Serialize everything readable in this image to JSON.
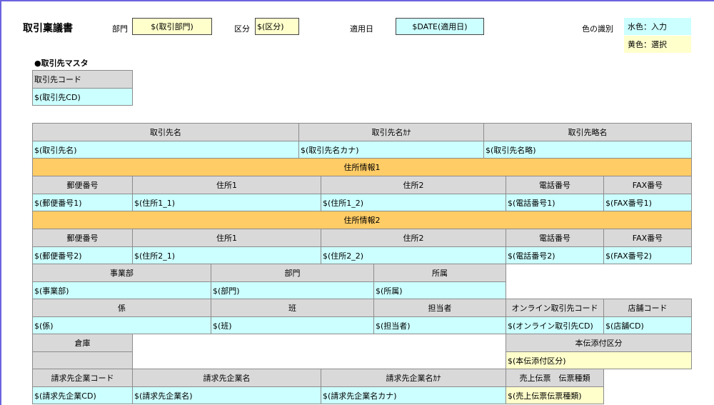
{
  "header": {
    "title": "取引稟議書",
    "dept_label": "部門",
    "dept_value": "$(取引部門)",
    "category_label": "区分",
    "category_value": "$(区分)",
    "apply_date_label": "適用日",
    "apply_date_value": "$DATE(適用日)",
    "color_legend_label": "色の識別",
    "legend_input": "水色：入力",
    "legend_select": "黄色：選択"
  },
  "master": {
    "section_title": "●取引先マスタ",
    "code_header": "取引先コード",
    "code_value": "$(取引先CD)"
  },
  "names": {
    "name_header": "取引先名",
    "kana_header": "取引先名ｶﾅ",
    "short_header": "取引先略名",
    "name_value": "$(取引先名)",
    "kana_value": "$(取引先名カナ)",
    "short_value": "$(取引先名略)"
  },
  "address1": {
    "band": "住所情報1",
    "zip_header": "郵便番号",
    "addr1_header": "住所1",
    "addr2_header": "住所2",
    "tel_header": "電話番号",
    "fax_header": "FAX番号",
    "zip_value": "$(郵便番号1)",
    "addr1_value": "$(住所1_1)",
    "addr2_value": "$(住所1_2)",
    "tel_value": "$(電話番号1)",
    "fax_value": "$(FAX番号1)"
  },
  "address2": {
    "band": "住所情報2",
    "zip_header": "郵便番号",
    "addr1_header": "住所1",
    "addr2_header": "住所2",
    "tel_header": "電話番号",
    "fax_header": "FAX番号",
    "zip_value": "$(郵便番号2)",
    "addr1_value": "$(住所2_1)",
    "addr2_value": "$(住所2_2)",
    "tel_value": "$(電話番号2)",
    "fax_value": "$(FAX番号2)"
  },
  "org": {
    "division_header": "事業部",
    "dept_header": "部門",
    "belong_header": "所属",
    "division_value": "$(事業部)",
    "dept_value": "$(部門)",
    "belong_value": "$(所属)"
  },
  "staff": {
    "section_header": "係",
    "team_header": "班",
    "person_header": "担当者",
    "online_header": "オンライン取引先コード",
    "store_header": "店舗コード",
    "section_value": "$(係)",
    "team_value": "$(班)",
    "person_value": "$(担当者)",
    "online_value": "$(オンライン取引先CD)",
    "store_value": "$(店舗CD)"
  },
  "warehouse": {
    "header": "倉庫",
    "slip_header": "本伝添付区分",
    "slip_value": "$(本伝添付区分)"
  },
  "billing": {
    "code_header": "請求先企業コード",
    "name_header": "請求先企業名",
    "kana_header": "請求先企業名ｶﾅ",
    "slip_type_header": "売上伝票　伝票種類",
    "code_value": "$(請求先企業CD)",
    "name_value": "$(請求先企業名)",
    "kana_value": "$(請求先企業名カナ)",
    "slip_type_value": "$(売上伝票伝票種類)"
  },
  "colors": {
    "input_cyan": "#ccffff",
    "select_yellow": "#ffffcc",
    "header_gray": "#d9d9d9",
    "band_orange": "#ffcc66"
  }
}
